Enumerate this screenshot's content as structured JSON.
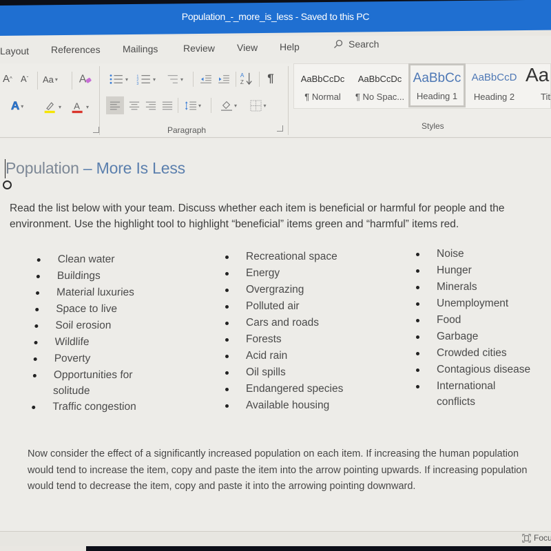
{
  "window": {
    "title": "Population_-_more_is_less - Saved to this PC"
  },
  "menu": {
    "items": [
      "Layout",
      "References",
      "Mailings",
      "Review",
      "View",
      "Help"
    ],
    "search_label": "Search"
  },
  "ribbon": {
    "font_group": {
      "grow_font": "A",
      "shrink_font": "A",
      "change_case": "Aa",
      "text_effects": "A",
      "font_color": "A"
    },
    "paragraph_group": {
      "label": "Paragraph",
      "sort_label": "A Z",
      "pilcrow": "¶"
    },
    "styles_group": {
      "label": "Styles",
      "styles": [
        {
          "sample": "AaBbCcDc",
          "name": "¶ Normal"
        },
        {
          "sample": "AaBbCcDc",
          "name": "¶ No Spac..."
        },
        {
          "sample": "AaBbCc",
          "name": "Heading 1",
          "selected": true
        },
        {
          "sample": "AaBbCcD",
          "name": "Heading 2"
        },
        {
          "sample": "Aa",
          "name": "Title"
        }
      ]
    },
    "colors": {
      "highlight": "#f5e400",
      "font_color": "#d9342b",
      "text_effects": "#2f7fd8"
    }
  },
  "document": {
    "title_first": "Population",
    "title_rest": " – More Is Less",
    "intro": "Read the list below with your team.  Discuss whether each item is beneficial or harmful for people and the environment.  Use the highlight tool to highlight “beneficial” items green and “harmful” items red.",
    "columns": [
      [
        "Clean water",
        "Buildings",
        "Material luxuries",
        "Space to live",
        "Soil erosion",
        "Wildlife",
        "Poverty",
        "Opportunities for solitude",
        "Traffic congestion"
      ],
      [
        "Recreational space",
        "Energy",
        "Overgrazing",
        "Polluted air",
        "Cars and roads",
        "Forests",
        "Acid rain",
        "Oil spills",
        "Endangered species",
        "Available housing"
      ],
      [
        "Noise",
        "Hunger",
        "Minerals",
        "Unemployment",
        "Food",
        "Garbage",
        "Crowded cities",
        "Contagious disease",
        "International conflicts"
      ]
    ],
    "instructions": "Now consider the effect of a significantly increased population on each item.  If increasing the human population would tend to increase the item, copy and paste the item into the arrow pointing upwards.  If increasing population would tend to decrease the item, copy and paste it into the arrowing pointing downward."
  },
  "statusbar": {
    "focus_label": "Focus"
  },
  "theme": {
    "titlebar": "#1f6fd1",
    "heading_color": "#5b7fad"
  }
}
